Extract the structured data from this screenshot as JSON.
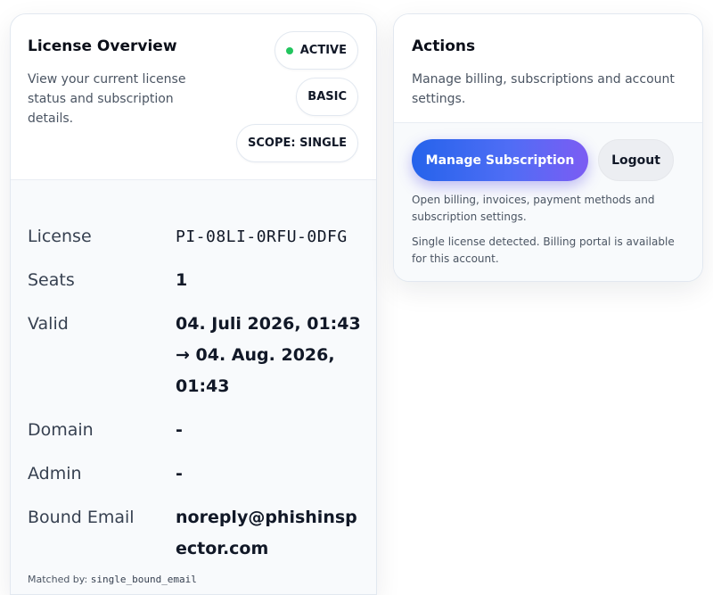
{
  "license": {
    "title": "License Overview",
    "description": "View your current license status and subscription details.",
    "status": "ACTIVE",
    "plan": "BASIC",
    "scope": "SCOPE: SINGLE",
    "rows": {
      "license_label": "License",
      "license_value": "PI-08LI-0RFU-0DFG",
      "seats_label": "Seats",
      "seats_value": "1",
      "valid_label": "Valid",
      "valid_value": "04. Juli 2026, 01:43 → 04. Aug. 2026, 01:43",
      "domain_label": "Domain",
      "domain_value": "-",
      "admin_label": "Admin",
      "admin_value": "-",
      "email_label": "Bound Email",
      "email_value": "noreply@phishinspector.com"
    },
    "matched_label": "Matched by:",
    "matched_value": "single_bound_email"
  },
  "actions": {
    "title": "Actions",
    "description": "Manage billing, subscriptions and account settings.",
    "manage_label": "Manage Subscription",
    "logout_label": "Logout",
    "note_billing": "Open billing, invoices, payment methods and subscription settings.",
    "note_single": "Single license detected. Billing portal is available for this account."
  },
  "colors": {
    "status_dot": "#22c55e",
    "primary_gradient_start": "#2563eb",
    "primary_gradient_end": "#7c5cf3"
  }
}
